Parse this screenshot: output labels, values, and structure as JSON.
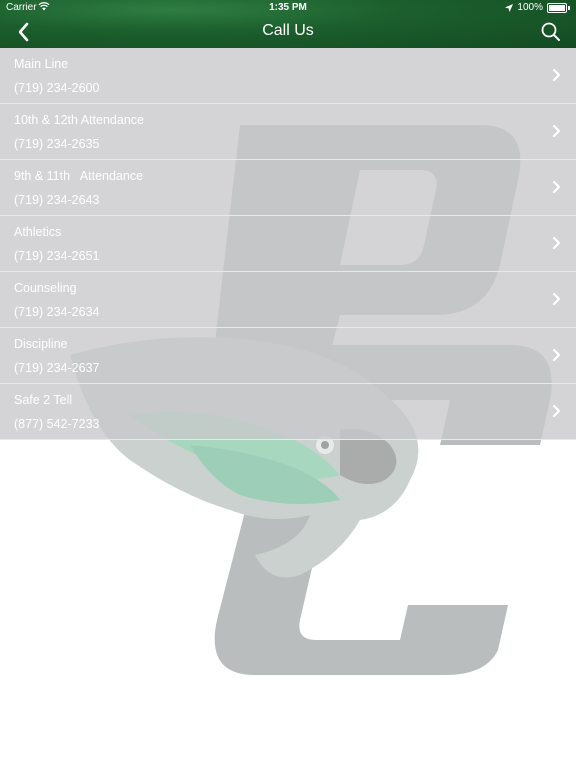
{
  "status_bar": {
    "carrier": "Carrier",
    "time": "1:35 PM",
    "battery": "100%"
  },
  "navbar": {
    "title": "Call Us",
    "back_icon": "chevron-left-icon",
    "search_icon": "search-icon"
  },
  "theme": {
    "header_green": "#1c5f2d",
    "row_gray": "#c8c8ca",
    "text": "#ffffff"
  },
  "contacts": [
    {
      "label": "Main Line",
      "phone": "(719) 234-2600"
    },
    {
      "label": "10th & 12th Attendance",
      "phone": "(719) 234-2635"
    },
    {
      "label": "9th & 11th   Attendance",
      "phone": "(719) 234-2643"
    },
    {
      "label": "Athletics",
      "phone": "(719) 234-2651"
    },
    {
      "label": "Counseling",
      "phone": "(719) 234-2634"
    },
    {
      "label": "Discipline",
      "phone": "(719) 234-2637"
    },
    {
      "label": "Safe 2 Tell",
      "phone": "(877) 542-7233"
    }
  ]
}
